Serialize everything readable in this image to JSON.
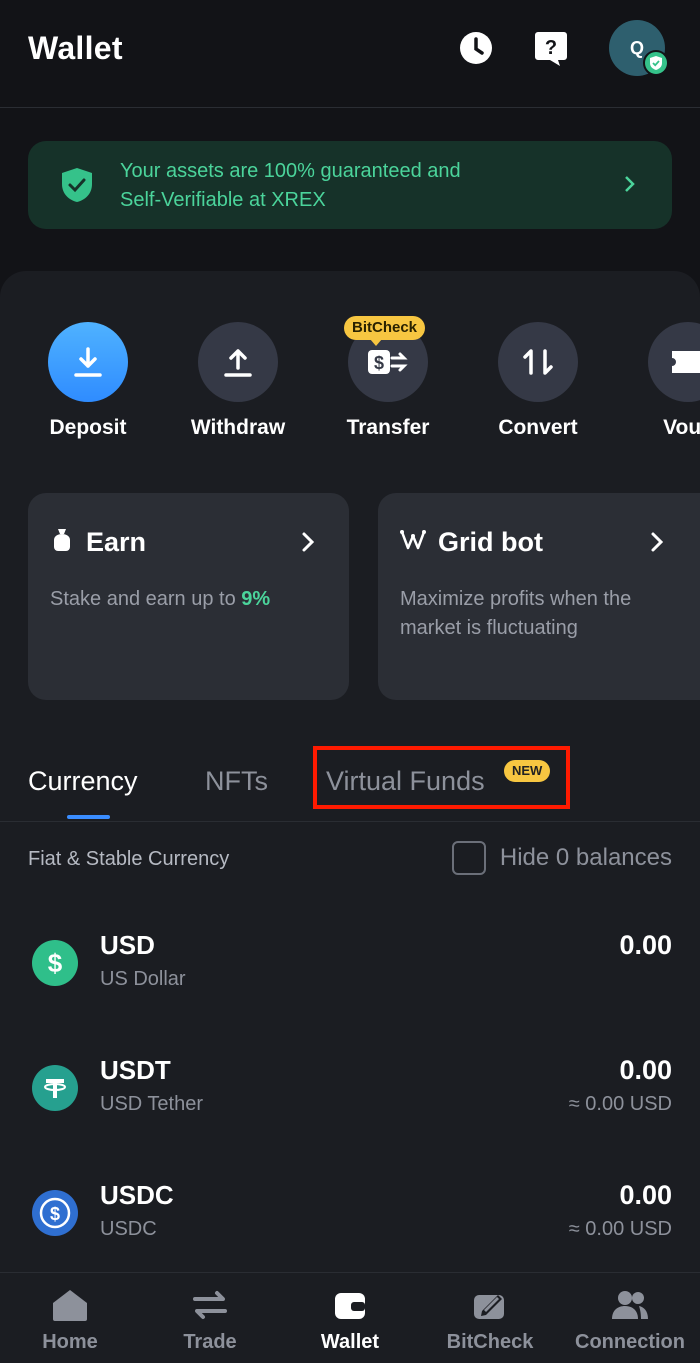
{
  "header": {
    "title": "Wallet",
    "avatar_initial": "Q"
  },
  "banner": {
    "line1": "Your assets are 100% guaranteed and",
    "line2": "Self-Verifiable at XREX"
  },
  "actions": [
    {
      "label": "Deposit",
      "icon": "download-icon"
    },
    {
      "label": "Withdraw",
      "icon": "upload-icon"
    },
    {
      "label": "Transfer",
      "icon": "transfer-icon",
      "tag": "BitCheck"
    },
    {
      "label": "Convert",
      "icon": "convert-icon"
    },
    {
      "label": "Vouc",
      "icon": "voucher-icon"
    }
  ],
  "cards": {
    "earn": {
      "title": "Earn",
      "desc_prefix": "Stake and earn up to ",
      "desc_highlight": "9%"
    },
    "gridbot": {
      "title": "Grid bot",
      "desc": "Maximize profits when the market is fluctuating"
    }
  },
  "tabs": {
    "currency": "Currency",
    "nfts": "NFTs",
    "virtual_funds": "Virtual Funds",
    "new_badge": "NEW"
  },
  "section": {
    "title": "Fiat & Stable Currency",
    "hide_zero": "Hide 0 balances"
  },
  "currencies": [
    {
      "symbol": "USD",
      "name": "US Dollar",
      "amount": "0.00",
      "approx": ""
    },
    {
      "symbol": "USDT",
      "name": "USD Tether",
      "amount": "0.00",
      "approx": "≈ 0.00 USD"
    },
    {
      "symbol": "USDC",
      "name": "USDC",
      "amount": "0.00",
      "approx": "≈ 0.00 USD"
    }
  ],
  "nav": {
    "home": "Home",
    "trade": "Trade",
    "wallet": "Wallet",
    "bitcheck": "BitCheck",
    "connection": "Connection"
  },
  "colors": {
    "accent_blue": "#3a8dff",
    "green": "#4bd49b",
    "badge_yellow": "#f7c641",
    "highlight_red": "#ff1a00"
  }
}
